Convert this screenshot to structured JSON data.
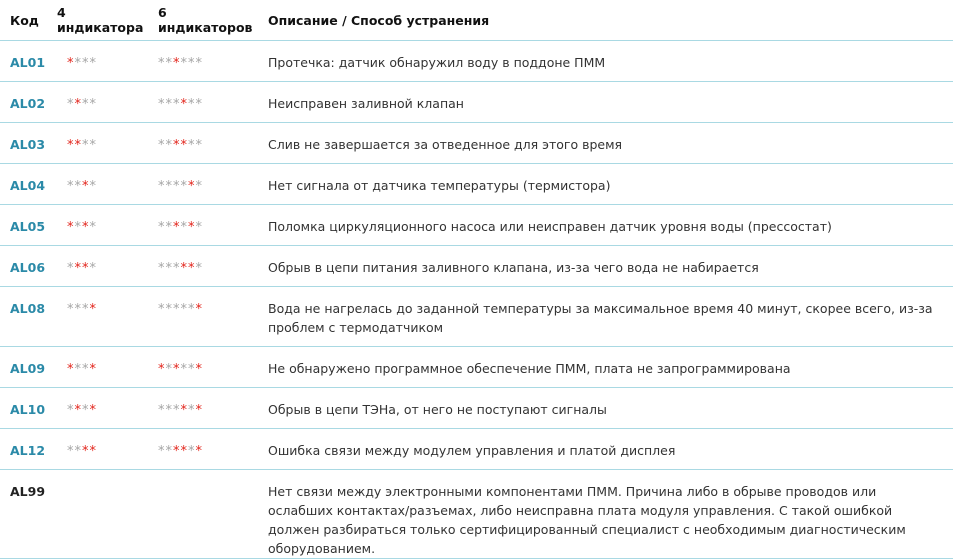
{
  "headers": {
    "code": "Код",
    "ind4": "4 индикатора",
    "ind6": "6 индикаторов",
    "desc": "Описание / Способ устранения"
  },
  "colors": {
    "link": "#2b8aa8",
    "lit": "#e2231a",
    "unlit": "#a5a5a5",
    "border": "#a9d9e3"
  },
  "rows": [
    {
      "code": "AL01",
      "ind4": [
        1,
        0,
        0,
        0
      ],
      "ind6": [
        0,
        0,
        1,
        0,
        0,
        0
      ],
      "desc": "Протечка: датчик обнаружил воду в поддоне ПММ"
    },
    {
      "code": "AL02",
      "ind4": [
        0,
        1,
        0,
        0
      ],
      "ind6": [
        0,
        0,
        0,
        1,
        0,
        0
      ],
      "desc": "Неисправен заливной клапан"
    },
    {
      "code": "AL03",
      "ind4": [
        1,
        1,
        0,
        0
      ],
      "ind6": [
        0,
        0,
        1,
        1,
        0,
        0
      ],
      "desc": "Слив не завершается за отведенное для этого время"
    },
    {
      "code": "AL04",
      "ind4": [
        0,
        0,
        1,
        0
      ],
      "ind6": [
        0,
        0,
        0,
        0,
        1,
        0
      ],
      "desc": "Нет сигнала от датчика температуры (термистора)"
    },
    {
      "code": "AL05",
      "ind4": [
        1,
        0,
        1,
        0
      ],
      "ind6": [
        0,
        0,
        1,
        0,
        1,
        0
      ],
      "desc": "Поломка циркуляционного насоса или неисправен датчик уровня воды (прессостат)"
    },
    {
      "code": "AL06",
      "ind4": [
        0,
        1,
        1,
        0
      ],
      "ind6": [
        0,
        0,
        0,
        1,
        1,
        0
      ],
      "desc": "Обрыв в цепи питания заливного клапана, из-за чего вода не набирается"
    },
    {
      "code": "AL08",
      "ind4": [
        0,
        0,
        0,
        1
      ],
      "ind6": [
        0,
        0,
        0,
        0,
        0,
        1
      ],
      "desc": "Вода не нагрелась до заданной температуры за максимальное время 40 минут, скорее всего, из-за проблем с термодатчиком"
    },
    {
      "code": "AL09",
      "ind4": [
        1,
        0,
        0,
        1
      ],
      "ind6": [
        1,
        0,
        1,
        0,
        0,
        1
      ],
      "desc": "Не обнаружено программное обеспечение ПММ, плата не запрограммирована"
    },
    {
      "code": "AL10",
      "ind4": [
        0,
        1,
        0,
        1
      ],
      "ind6": [
        0,
        0,
        0,
        1,
        0,
        1
      ],
      "desc": "Обрыв в цепи ТЭНа, от него не поступают сигналы"
    },
    {
      "code": "AL12",
      "ind4": [
        0,
        0,
        1,
        1
      ],
      "ind6": [
        0,
        0,
        1,
        1,
        0,
        1
      ],
      "desc": "Ошибка связи между модулем управления и платой дисплея"
    },
    {
      "code": "AL99",
      "ind4": [],
      "ind6": [],
      "desc": "Нет связи между электронными компонентами ПММ. Причина либо в обрыве проводов или ослабших контактах/разъемах, либо неисправна плата модуля управления. С такой ошибкой должен разбираться только сертифицированный специалист с необходимым диагностическим оборудованием."
    }
  ]
}
